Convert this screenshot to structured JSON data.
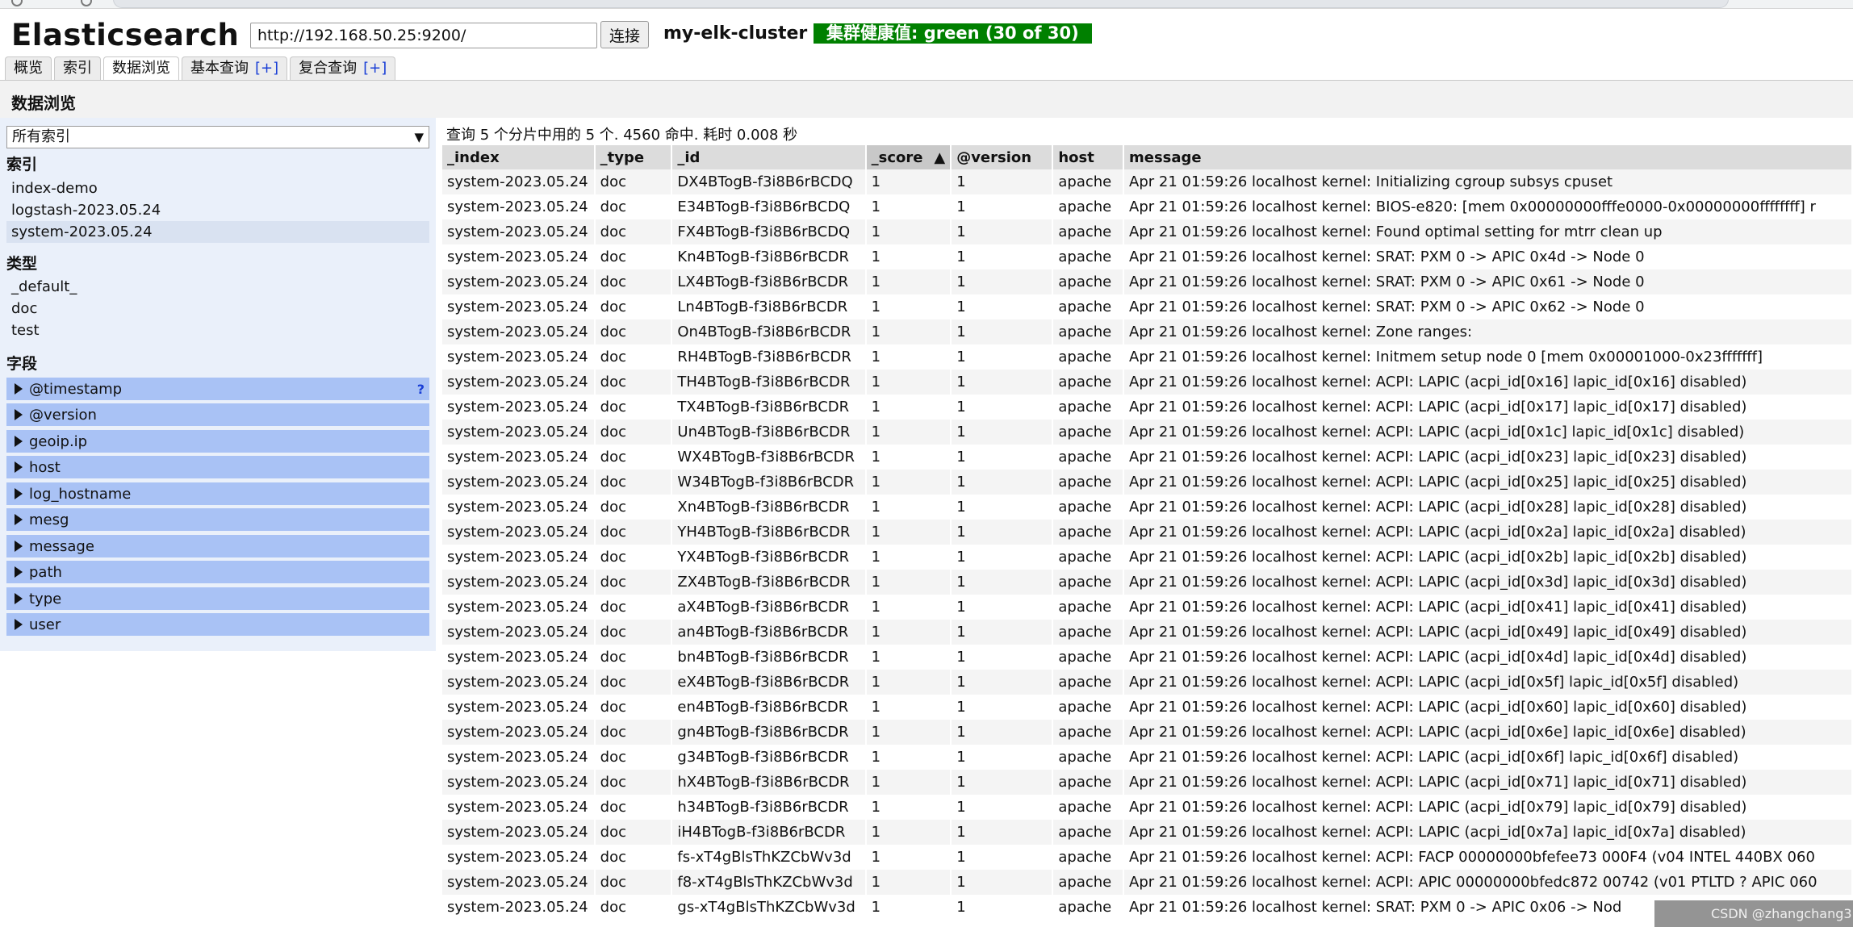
{
  "app": {
    "logo": "Elasticsearch",
    "url_value": "http://192.168.50.25:9200/",
    "connect_label": "连接",
    "cluster_name": "my-elk-cluster",
    "health": "集群健康值: green (30 of 30)"
  },
  "tabs": [
    {
      "label": "概览",
      "plus": ""
    },
    {
      "label": "索引",
      "plus": ""
    },
    {
      "label": "数据浏览",
      "plus": ""
    },
    {
      "label": "基本查询",
      "plus": "[+]"
    },
    {
      "label": "复合查询",
      "plus": "[+]"
    }
  ],
  "section_title": "数据浏览",
  "sidebar": {
    "index_select": "所有索引",
    "indices_heading": "索引",
    "indices": [
      "index-demo",
      "logstash-2023.05.24",
      "system-2023.05.24"
    ],
    "types_heading": "类型",
    "types": [
      "_default_",
      "doc",
      "test"
    ],
    "fields_heading": "字段",
    "fields": [
      "@timestamp",
      "@version",
      "geoip.ip",
      "host",
      "log_hostname",
      "mesg",
      "message",
      "path",
      "type",
      "user"
    ],
    "help_mark": "?"
  },
  "summary": "查询 5 个分片中用的 5 个. 4560 命中. 耗时 0.008 秒",
  "table": {
    "headers": [
      "_index",
      "_type",
      "_id",
      "_score",
      "@version",
      "host",
      "message"
    ],
    "sort_indicator": "▲",
    "rows": [
      [
        "system-2023.05.24",
        "doc",
        "DX4BTogB-f3i8B6rBCDQ",
        "1",
        "1",
        "apache",
        "Apr 21 01:59:26 localhost kernel: Initializing cgroup subsys cpuset"
      ],
      [
        "system-2023.05.24",
        "doc",
        "E34BTogB-f3i8B6rBCDQ",
        "1",
        "1",
        "apache",
        "Apr 21 01:59:26 localhost kernel: BIOS-e820: [mem 0x00000000fffe0000-0x00000000ffffffff] r"
      ],
      [
        "system-2023.05.24",
        "doc",
        "FX4BTogB-f3i8B6rBCDQ",
        "1",
        "1",
        "apache",
        "Apr 21 01:59:26 localhost kernel: Found optimal setting for mtrr clean up"
      ],
      [
        "system-2023.05.24",
        "doc",
        "Kn4BTogB-f3i8B6rBCDR",
        "1",
        "1",
        "apache",
        "Apr 21 01:59:26 localhost kernel: SRAT: PXM 0 -> APIC 0x4d -> Node 0"
      ],
      [
        "system-2023.05.24",
        "doc",
        "LX4BTogB-f3i8B6rBCDR",
        "1",
        "1",
        "apache",
        "Apr 21 01:59:26 localhost kernel: SRAT: PXM 0 -> APIC 0x61 -> Node 0"
      ],
      [
        "system-2023.05.24",
        "doc",
        "Ln4BTogB-f3i8B6rBCDR",
        "1",
        "1",
        "apache",
        "Apr 21 01:59:26 localhost kernel: SRAT: PXM 0 -> APIC 0x62 -> Node 0"
      ],
      [
        "system-2023.05.24",
        "doc",
        "On4BTogB-f3i8B6rBCDR",
        "1",
        "1",
        "apache",
        "Apr 21 01:59:26 localhost kernel: Zone ranges:"
      ],
      [
        "system-2023.05.24",
        "doc",
        "RH4BTogB-f3i8B6rBCDR",
        "1",
        "1",
        "apache",
        "Apr 21 01:59:26 localhost kernel: Initmem setup node 0 [mem 0x00001000-0x23fffffff]"
      ],
      [
        "system-2023.05.24",
        "doc",
        "TH4BTogB-f3i8B6rBCDR",
        "1",
        "1",
        "apache",
        "Apr 21 01:59:26 localhost kernel: ACPI: LAPIC (acpi_id[0x16] lapic_id[0x16] disabled)"
      ],
      [
        "system-2023.05.24",
        "doc",
        "TX4BTogB-f3i8B6rBCDR",
        "1",
        "1",
        "apache",
        "Apr 21 01:59:26 localhost kernel: ACPI: LAPIC (acpi_id[0x17] lapic_id[0x17] disabled)"
      ],
      [
        "system-2023.05.24",
        "doc",
        "Un4BTogB-f3i8B6rBCDR",
        "1",
        "1",
        "apache",
        "Apr 21 01:59:26 localhost kernel: ACPI: LAPIC (acpi_id[0x1c] lapic_id[0x1c] disabled)"
      ],
      [
        "system-2023.05.24",
        "doc",
        "WX4BTogB-f3i8B6rBCDR",
        "1",
        "1",
        "apache",
        "Apr 21 01:59:26 localhost kernel: ACPI: LAPIC (acpi_id[0x23] lapic_id[0x23] disabled)"
      ],
      [
        "system-2023.05.24",
        "doc",
        "W34BTogB-f3i8B6rBCDR",
        "1",
        "1",
        "apache",
        "Apr 21 01:59:26 localhost kernel: ACPI: LAPIC (acpi_id[0x25] lapic_id[0x25] disabled)"
      ],
      [
        "system-2023.05.24",
        "doc",
        "Xn4BTogB-f3i8B6rBCDR",
        "1",
        "1",
        "apache",
        "Apr 21 01:59:26 localhost kernel: ACPI: LAPIC (acpi_id[0x28] lapic_id[0x28] disabled)"
      ],
      [
        "system-2023.05.24",
        "doc",
        "YH4BTogB-f3i8B6rBCDR",
        "1",
        "1",
        "apache",
        "Apr 21 01:59:26 localhost kernel: ACPI: LAPIC (acpi_id[0x2a] lapic_id[0x2a] disabled)"
      ],
      [
        "system-2023.05.24",
        "doc",
        "YX4BTogB-f3i8B6rBCDR",
        "1",
        "1",
        "apache",
        "Apr 21 01:59:26 localhost kernel: ACPI: LAPIC (acpi_id[0x2b] lapic_id[0x2b] disabled)"
      ],
      [
        "system-2023.05.24",
        "doc",
        "ZX4BTogB-f3i8B6rBCDR",
        "1",
        "1",
        "apache",
        "Apr 21 01:59:26 localhost kernel: ACPI: LAPIC (acpi_id[0x3d] lapic_id[0x3d] disabled)"
      ],
      [
        "system-2023.05.24",
        "doc",
        "aX4BTogB-f3i8B6rBCDR",
        "1",
        "1",
        "apache",
        "Apr 21 01:59:26 localhost kernel: ACPI: LAPIC (acpi_id[0x41] lapic_id[0x41] disabled)"
      ],
      [
        "system-2023.05.24",
        "doc",
        "an4BTogB-f3i8B6rBCDR",
        "1",
        "1",
        "apache",
        "Apr 21 01:59:26 localhost kernel: ACPI: LAPIC (acpi_id[0x49] lapic_id[0x49] disabled)"
      ],
      [
        "system-2023.05.24",
        "doc",
        "bn4BTogB-f3i8B6rBCDR",
        "1",
        "1",
        "apache",
        "Apr 21 01:59:26 localhost kernel: ACPI: LAPIC (acpi_id[0x4d] lapic_id[0x4d] disabled)"
      ],
      [
        "system-2023.05.24",
        "doc",
        "eX4BTogB-f3i8B6rBCDR",
        "1",
        "1",
        "apache",
        "Apr 21 01:59:26 localhost kernel: ACPI: LAPIC (acpi_id[0x5f] lapic_id[0x5f] disabled)"
      ],
      [
        "system-2023.05.24",
        "doc",
        "en4BTogB-f3i8B6rBCDR",
        "1",
        "1",
        "apache",
        "Apr 21 01:59:26 localhost kernel: ACPI: LAPIC (acpi_id[0x60] lapic_id[0x60] disabled)"
      ],
      [
        "system-2023.05.24",
        "doc",
        "gn4BTogB-f3i8B6rBCDR",
        "1",
        "1",
        "apache",
        "Apr 21 01:59:26 localhost kernel: ACPI: LAPIC (acpi_id[0x6e] lapic_id[0x6e] disabled)"
      ],
      [
        "system-2023.05.24",
        "doc",
        "g34BTogB-f3i8B6rBCDR",
        "1",
        "1",
        "apache",
        "Apr 21 01:59:26 localhost kernel: ACPI: LAPIC (acpi_id[0x6f] lapic_id[0x6f] disabled)"
      ],
      [
        "system-2023.05.24",
        "doc",
        "hX4BTogB-f3i8B6rBCDR",
        "1",
        "1",
        "apache",
        "Apr 21 01:59:26 localhost kernel: ACPI: LAPIC (acpi_id[0x71] lapic_id[0x71] disabled)"
      ],
      [
        "system-2023.05.24",
        "doc",
        "h34BTogB-f3i8B6rBCDR",
        "1",
        "1",
        "apache",
        "Apr 21 01:59:26 localhost kernel: ACPI: LAPIC (acpi_id[0x79] lapic_id[0x79] disabled)"
      ],
      [
        "system-2023.05.24",
        "doc",
        "iH4BTogB-f3i8B6rBCDR",
        "1",
        "1",
        "apache",
        "Apr 21 01:59:26 localhost kernel: ACPI: LAPIC (acpi_id[0x7a] lapic_id[0x7a] disabled)"
      ],
      [
        "system-2023.05.24",
        "doc",
        "fs-xT4gBlsThKZCbWv3d",
        "1",
        "1",
        "apache",
        "Apr 21 01:59:26 localhost kernel: ACPI: FACP 00000000bfefee73 000F4 (v04 INTEL 440BX 060"
      ],
      [
        "system-2023.05.24",
        "doc",
        "f8-xT4gBlsThKZCbWv3d",
        "1",
        "1",
        "apache",
        "Apr 21 01:59:26 localhost kernel: ACPI: APIC 00000000bfedc872 00742 (v01 PTLTD ? APIC 060"
      ],
      [
        "system-2023.05.24",
        "doc",
        "gs-xT4gBlsThKZCbWv3d",
        "1",
        "1",
        "apache",
        "Apr 21 01:59:26 localhost kernel: SRAT: PXM 0 -> APIC 0x06 -> Nod"
      ]
    ]
  },
  "watermark": "CSDN @zhangchang3"
}
